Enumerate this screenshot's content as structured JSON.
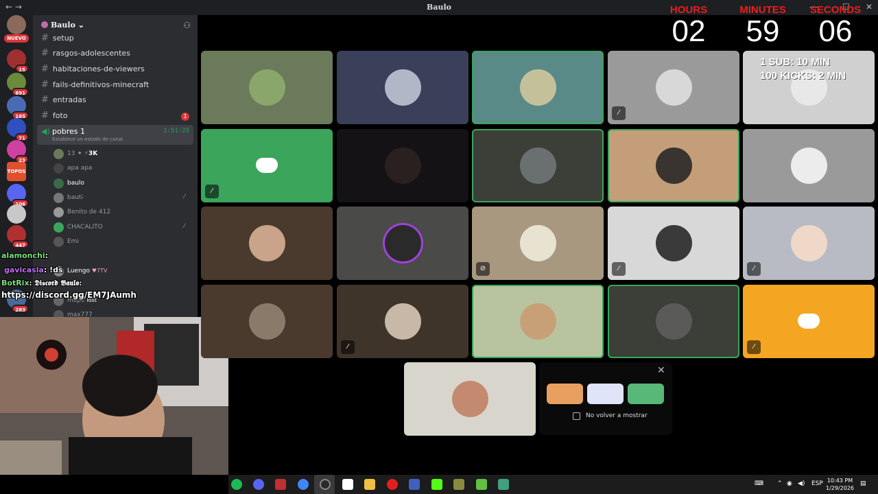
{
  "window": {
    "title": "Baulo",
    "nav": "←  →",
    "minimize": "—",
    "maximize": "☐",
    "close": "✕"
  },
  "server_rail": {
    "new_badge": "NUEVO",
    "badges": [
      "15",
      "691",
      "165",
      "71",
      "23",
      "106",
      "447",
      "283"
    ],
    "topos_label": "TOPOS"
  },
  "sidebar": {
    "server_name": "Baulo",
    "channels": [
      {
        "name": "setup"
      },
      {
        "name": "rasgos-adolescentes"
      },
      {
        "name": "habitaciones-de-viewers"
      },
      {
        "name": "fails-definitivos-minecraft"
      },
      {
        "name": "entradas"
      },
      {
        "name": "foto",
        "unread": "1"
      }
    ],
    "voice_channel": {
      "name": "pobres 1",
      "time": "1:51:25",
      "status": "Establece un estado de canal"
    },
    "voice_users": [
      {
        "name": "13",
        "extra": "3K"
      },
      {
        "name": "apa apa"
      },
      {
        "name": "baulo"
      },
      {
        "name": "bauti",
        "muted": true
      },
      {
        "name": "Benito de 412"
      },
      {
        "name": "CHACALITO",
        "muted": true
      },
      {
        "name": "Emi"
      },
      {
        "name": "Luengo",
        "extra": "7TV"
      },
      {
        "name": "mape",
        "extra": "lost"
      },
      {
        "name": "max777"
      }
    ]
  },
  "chat_overlay": [
    {
      "user": "alamonchi",
      "text": ":",
      "color": "#7be07b"
    },
    {
      "user": "gavicasla",
      "text": ": !ds",
      "color": "#c46ef2"
    },
    {
      "user": "BotRix",
      "text": ": 𝕯𝖎𝖘𝖈𝖔𝖗𝖉 𝕭𝖆𝖚𝖑𝖔:",
      "color": "#7be07b"
    },
    {
      "user": "",
      "text": "https://discord.gg/EM7JAumh",
      "color": "#ffffff"
    }
  ],
  "timer": {
    "hours_label": "HOURS",
    "minutes_label": "MINUTES",
    "seconds_label": "SECONDS",
    "hours": "02",
    "minutes": "59",
    "seconds": "06",
    "rule1": "1 SUB: 10 MIN",
    "rule2": "100 KICKS: 2 MIN"
  },
  "activity_popup": {
    "checkbox_label": "No volver a mostrar",
    "close": "✕"
  },
  "taskbar": {
    "lang": "ESP",
    "time": "10:43 PM",
    "date": "1/29/2026"
  },
  "colors": {
    "discord_green": "#3ba55c",
    "discord_blurple": "#5865f2",
    "timer_red": "#e81f1f",
    "badge_red": "#da373c"
  }
}
